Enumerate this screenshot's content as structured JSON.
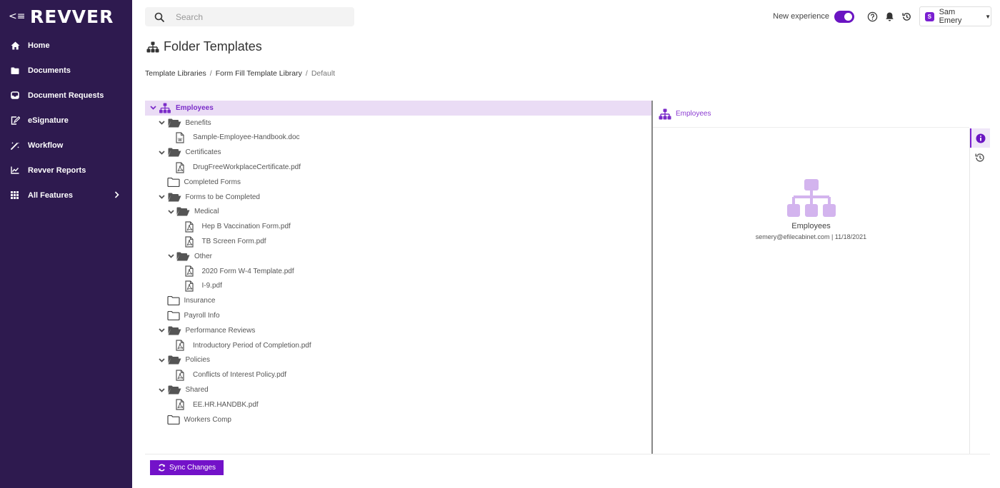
{
  "sidebar": {
    "collapse_icon": "collapse-menu-icon",
    "logo": "REVVER",
    "items": [
      {
        "label": "Home",
        "icon": "home-icon"
      },
      {
        "label": "Documents",
        "icon": "folder-icon"
      },
      {
        "label": "Document Requests",
        "icon": "inbox-icon"
      },
      {
        "label": "eSignature",
        "icon": "signature-icon"
      },
      {
        "label": "Workflow",
        "icon": "magic-wand-icon"
      },
      {
        "label": "Revver Reports",
        "icon": "chart-icon"
      },
      {
        "label": "All Features",
        "icon": "grid-icon",
        "has_chevron": true
      }
    ]
  },
  "topbar": {
    "search": {
      "placeholder": "Search",
      "value": ""
    },
    "new_experience_label": "New experience",
    "new_experience_on": true,
    "icons": [
      "help-icon",
      "bell-icon",
      "history-icon"
    ],
    "user": {
      "initial": "S",
      "name": "Sam Emery"
    }
  },
  "page": {
    "title": "Folder Templates",
    "breadcrumb": [
      "Template Libraries",
      "Form Fill Template Library",
      "Default"
    ]
  },
  "tree": {
    "rows": [
      {
        "label": "Employees",
        "type": "root",
        "level": 0,
        "expanded": true,
        "selected": true
      },
      {
        "label": "Benefits",
        "type": "folder-open",
        "level": 1,
        "expanded": true
      },
      {
        "label": "Sample-Employee-Handbook.doc",
        "type": "word",
        "level": 2
      },
      {
        "label": "Certificates",
        "type": "folder-open",
        "level": 1,
        "expanded": true
      },
      {
        "label": "DrugFreeWorkplaceCertificate.pdf",
        "type": "pdf",
        "level": 2
      },
      {
        "label": "Completed Forms",
        "type": "folder",
        "level": 1
      },
      {
        "label": "Forms to be Completed",
        "type": "folder-open",
        "level": 1,
        "expanded": true
      },
      {
        "label": "Medical",
        "type": "folder-open",
        "level": 2,
        "expanded": true
      },
      {
        "label": "Hep B Vaccination Form.pdf",
        "type": "pdf",
        "level": 3
      },
      {
        "label": "TB Screen Form.pdf",
        "type": "pdf",
        "level": 3
      },
      {
        "label": "Other",
        "type": "folder-open",
        "level": 2,
        "expanded": true
      },
      {
        "label": "2020 Form W-4 Template.pdf",
        "type": "pdf",
        "level": 3
      },
      {
        "label": "I-9.pdf",
        "type": "pdf",
        "level": 3
      },
      {
        "label": "Insurance",
        "type": "folder",
        "level": 1
      },
      {
        "label": "Payroll Info",
        "type": "folder",
        "level": 1
      },
      {
        "label": "Performance Reviews",
        "type": "folder-open",
        "level": 1,
        "expanded": true
      },
      {
        "label": "Introductory Period of Completion.pdf",
        "type": "pdf",
        "level": 2
      },
      {
        "label": "Policies",
        "type": "folder-open",
        "level": 1,
        "expanded": true
      },
      {
        "label": "Conflicts of Interest Policy.pdf",
        "type": "pdf",
        "level": 2
      },
      {
        "label": "Shared",
        "type": "folder-open",
        "level": 1,
        "expanded": true
      },
      {
        "label": "EE.HR.HANDBK.pdf",
        "type": "pdf",
        "level": 2
      },
      {
        "label": "Workers Comp",
        "type": "folder",
        "level": 1
      }
    ]
  },
  "detail": {
    "header_label": "Employees",
    "name": "Employees",
    "meta": "semery@efilecabinet.com | 11/18/2021",
    "tabs": [
      {
        "icon": "info-icon",
        "active": true
      },
      {
        "icon": "history-icon",
        "active": false
      }
    ]
  },
  "footer": {
    "sync_label": "Sync Changes"
  },
  "colors": {
    "sidebar_bg": "#2e1a4f",
    "accent": "#7312c9",
    "selected_row_bg": "#eadcf5",
    "big_icon": "#d3b4ee"
  }
}
